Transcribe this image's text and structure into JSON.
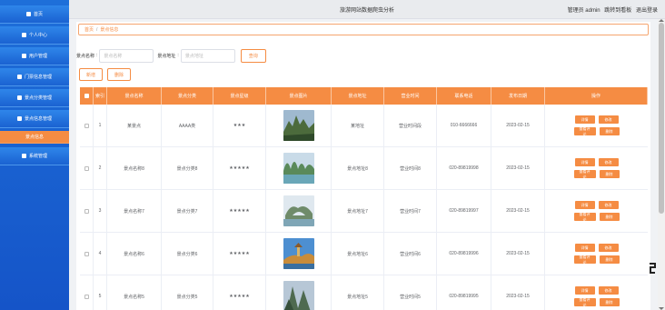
{
  "header": {
    "title": "旅游网站数据爬虫分析",
    "admin_label": "管理员 admin",
    "front_link": "跳转到看板",
    "logout": "退出登录"
  },
  "sidebar": {
    "items": [
      {
        "label": "首页",
        "icon": "home-icon"
      },
      {
        "label": "个人中心",
        "icon": "user-icon"
      },
      {
        "label": "用户管理",
        "icon": "grid-icon"
      },
      {
        "label": "门票信息管理",
        "icon": "grid-icon"
      },
      {
        "label": "景点分类管理",
        "icon": "monitor-icon"
      },
      {
        "label": "景点信息管理",
        "icon": "flag-icon"
      },
      {
        "label": "景点信息",
        "icon": ""
      },
      {
        "label": "系统管理",
        "icon": "grid-icon"
      }
    ]
  },
  "breadcrumb": {
    "home": "首页",
    "current": "景点信息"
  },
  "search": {
    "name_label": "景点名称",
    "name_placeholder": "景点名称",
    "addr_label": "景点地址",
    "addr_placeholder": "景点地址",
    "query_button": "查询"
  },
  "actions": {
    "add": "新增",
    "delete": "删除"
  },
  "table": {
    "headers": [
      "索引",
      "景点名称",
      "景点分类",
      "景点星级",
      "景点图片",
      "景点地址",
      "营业时间",
      "联系电话",
      "发布日期",
      "操作"
    ],
    "rows": [
      {
        "index": "1",
        "name": "某景点",
        "category": "AAAA类",
        "stars": "★★★",
        "address": "某地址",
        "hours": "营业时间段",
        "phone": "010-6666666",
        "date": "2023-02-15",
        "img": "sky"
      },
      {
        "index": "2",
        "name": "景点名称8",
        "category": "景点分类8",
        "stars": "★★★★★",
        "address": "景点地址8",
        "hours": "营业时间8",
        "phone": "020-89819998",
        "date": "2023-02-15",
        "img": "karst"
      },
      {
        "index": "3",
        "name": "景点名称7",
        "category": "景点分类7",
        "stars": "★★★★★",
        "address": "景点地址7",
        "hours": "营业时间7",
        "phone": "020-89819997",
        "date": "2023-02-15",
        "img": "arch"
      },
      {
        "index": "4",
        "name": "景点名称6",
        "category": "景点分类6",
        "stars": "★★★★★",
        "address": "景点地址6",
        "hours": "营业时间6",
        "phone": "020-89819996",
        "date": "2023-02-15",
        "img": "pagoda"
      },
      {
        "index": "5",
        "name": "景点名称5",
        "category": "景点分类5",
        "stars": "★★★★★",
        "address": "景点地址5",
        "hours": "营业时间5",
        "phone": "020-89819995",
        "date": "2023-02-15",
        "img": "peak"
      }
    ],
    "ops": {
      "detail": "详情",
      "edit": "修改",
      "comments": "查看评论",
      "remove": "删除"
    }
  },
  "colors": {
    "accent": "#f58c43",
    "sidebar": "#1a62d1"
  }
}
